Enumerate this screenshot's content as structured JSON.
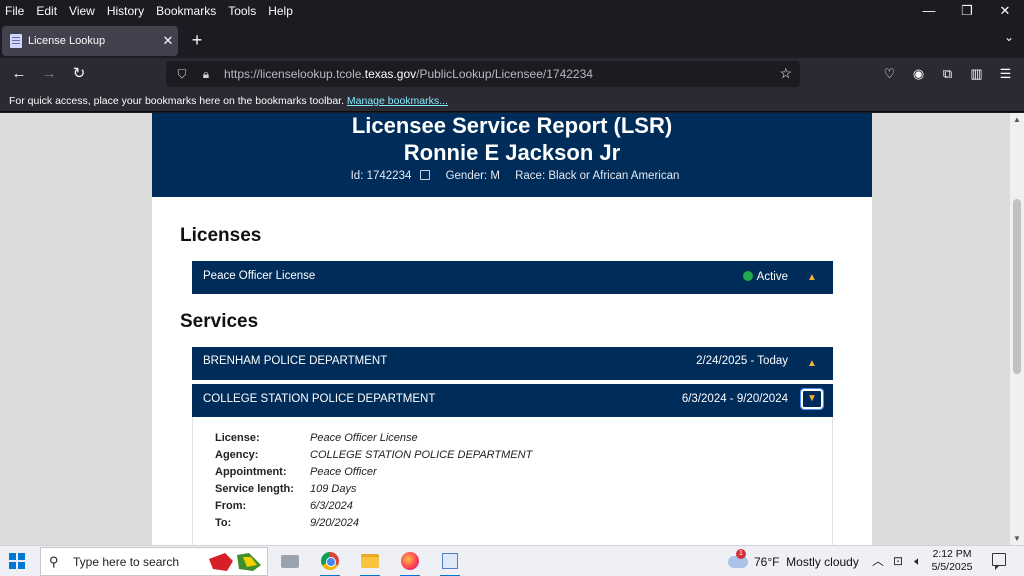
{
  "menubar": {
    "items": [
      "File",
      "Edit",
      "View",
      "History",
      "Bookmarks",
      "Tools",
      "Help"
    ]
  },
  "window_controls": {
    "minimize": "—",
    "restore": "❐",
    "close": "✕"
  },
  "tab": {
    "title": "License Lookup",
    "close": "✕"
  },
  "newtab_label": "+",
  "tablist_icon": "⌄",
  "nav": {
    "url_prefix": "https://licenselookup.tcole.",
    "url_domain": "texas.gov",
    "url_suffix": "/PublicLookup/Licensee/1742234"
  },
  "bookmarks": {
    "text": "For quick access, place your bookmarks here on the bookmarks toolbar.",
    "link": "Manage bookmarks..."
  },
  "report": {
    "title": "Licensee Service Report (LSR)",
    "name": "Ronnie E Jackson Jr",
    "id": "Id: 1742234",
    "gender": "Gender: M",
    "race": "Race: Black or African American"
  },
  "licenses": {
    "heading": "Licenses",
    "items": [
      {
        "name": "Peace Officer License",
        "status": "Active",
        "status_color": "#22a94e"
      }
    ]
  },
  "services": {
    "heading": "Services",
    "items": [
      {
        "agency": "BRENHAM POLICE DEPARTMENT",
        "dates": "2/24/2025 - Today",
        "expanded": false
      },
      {
        "agency": "COLLEGE STATION POLICE DEPARTMENT",
        "dates": "6/3/2024 - 9/20/2024",
        "expanded": true
      }
    ],
    "details": [
      {
        "label": "License:",
        "value": "Peace Officer License"
      },
      {
        "label": "Agency:",
        "value": "COLLEGE STATION POLICE DEPARTMENT"
      },
      {
        "label": "Appointment:",
        "value": "Peace Officer"
      },
      {
        "label": "Service length:",
        "value": "109 Days"
      },
      {
        "label": "From:",
        "value": "6/3/2024"
      },
      {
        "label": "To:",
        "value": "9/20/2024"
      }
    ]
  },
  "toggles": {
    "collapsed": "▲",
    "expanded": "▼"
  },
  "taskbar": {
    "search_placeholder": "Type here to search",
    "weather": "76°F  Mostly cloudy",
    "weather_badge": "1",
    "time": "2:12 PM",
    "date": "5/5/2025"
  },
  "colors": {
    "header_bg": "#002c5a",
    "accent_arrow": "#f2b134",
    "active_status": "#22a94e"
  }
}
